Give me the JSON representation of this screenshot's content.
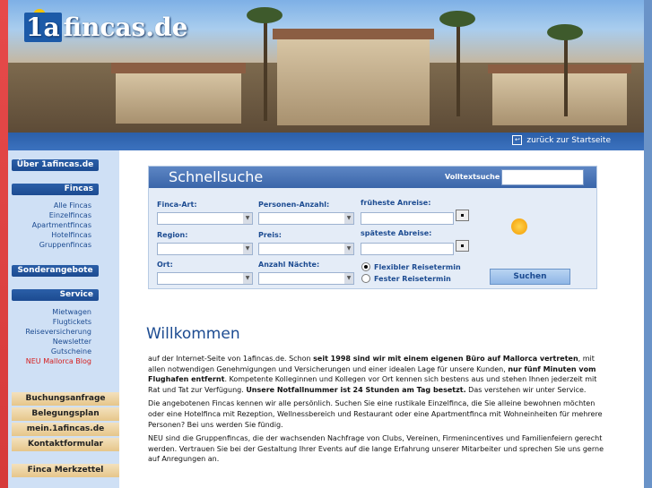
{
  "header": {
    "logo_prefix": "1a",
    "logo_suffix": "fincas.de",
    "back_link": "zurück zur Startseite"
  },
  "sidebar": {
    "about": "Über 1afincas.de",
    "fincas_title": "Fincas",
    "fincas_links": [
      "Alle Fincas",
      "Einzelfincas",
      "Apartmentfincas",
      "Hotelfincas",
      "Gruppenfincas"
    ],
    "special": "Sonderangebote",
    "service_title": "Service",
    "service_links": [
      "Mietwagen",
      "Flugtickets",
      "Reiseversicherung",
      "Newsletter",
      "Gutscheine"
    ],
    "blog": "NEU Mallorca Blog",
    "booking": "Buchungsanfrage",
    "occupancy": "Belegungsplan",
    "mine": "mein.1afincas.de",
    "contact": "Kontaktformular",
    "notepad": "Finca Merkzettel"
  },
  "quick": {
    "title": "Schnellsuche",
    "fulltext_label": "Volltextsuche",
    "finca_art": "Finca-Art:",
    "persons": "Personen-Anzahl:",
    "earliest": "früheste Anreise:",
    "region": "Region:",
    "price": "Preis:",
    "latest": "späteste Abreise:",
    "place": "Ort:",
    "nights": "Anzahl Nächte:",
    "radio_flex": "Flexibler Reisetermin",
    "radio_fixed": "Fester Reisetermin",
    "search_button": "Suchen"
  },
  "welcome": {
    "title": "Willkommen",
    "p1_a": "auf der Internet-Seite von 1afincas.de. Schon ",
    "p1_b": "seit 1998 sind wir mit einem eigenen Büro auf Mallorca vertreten",
    "p1_c": ", mit allen notwendigen Genehmigungen und Versicherungen und einer idealen Lage für unsere Kunden, ",
    "p1_d": "nur fünf Minuten vom Flughafen entfernt",
    "p1_e": ". Kompetente Kolleginnen und Kollegen vor Ort kennen sich bestens aus und stehen Ihnen jederzeit mit Rat und Tat zur Verfügung. ",
    "p1_f": "Unsere Notfallnummer ist 24 Stunden am Tag besetzt.",
    "p1_g": " Das verstehen wir unter Service.",
    "p2": "Die angebotenen Fincas kennen wir alle persönlich. Suchen Sie eine rustikale Einzelfinca, die Sie alleine bewohnen möchten oder eine Hotelfinca mit Rezeption, Wellnessbereich und Restaurant oder eine Apartmentfinca mit Wohneinheiten für mehrere Personen? Bei uns werden Sie fündig.",
    "p3": "NEU sind die Gruppenfincas, die der wachsenden Nachfrage von Clubs, Vereinen, Firmenincentives und Familienfeiern gerecht werden. Vertrauen Sie bei der Gestaltung Ihrer Events auf die lange Erfahrung unserer Mitarbeiter und sprechen Sie uns gerne auf Anregungen an."
  }
}
